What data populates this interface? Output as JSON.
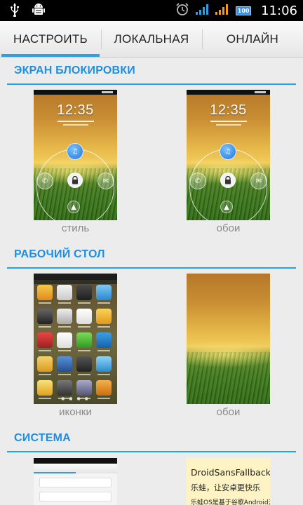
{
  "status_bar": {
    "time": "11:06",
    "battery": "100",
    "icons": [
      "usb-icon",
      "android-debug-icon",
      "alarm-icon",
      "wifi-signal-icon",
      "cell-signal-icon",
      "battery-icon"
    ]
  },
  "tabs": [
    {
      "label": "НАСТРОИТЬ",
      "active": true
    },
    {
      "label": "ЛОКАЛЬНАЯ",
      "active": false
    },
    {
      "label": "ОНЛАЙН",
      "active": false
    }
  ],
  "sections": {
    "lockscreen": {
      "title": "ЭКРАН БЛОКИРОВКИ",
      "items": [
        {
          "label": "стиль",
          "clock": "12:35"
        },
        {
          "label": "обои",
          "clock": "12:35"
        }
      ]
    },
    "desktop": {
      "title": "РАБОЧИЙ СТОЛ",
      "items": [
        {
          "label": "иконки"
        },
        {
          "label": "обои"
        }
      ]
    },
    "system": {
      "title": "СИСТЕМА",
      "font_preview": {
        "title": "DroidSansFallback",
        "line1": "乐蛙，让安卓更快乐",
        "line2": "乐蛙OS是基于谷歌Android开源"
      }
    }
  },
  "colors": {
    "accent": "#2aa0e6",
    "section_title": "#1e8fe0",
    "label_gray": "#8a8a8a",
    "background": "#ececec"
  }
}
